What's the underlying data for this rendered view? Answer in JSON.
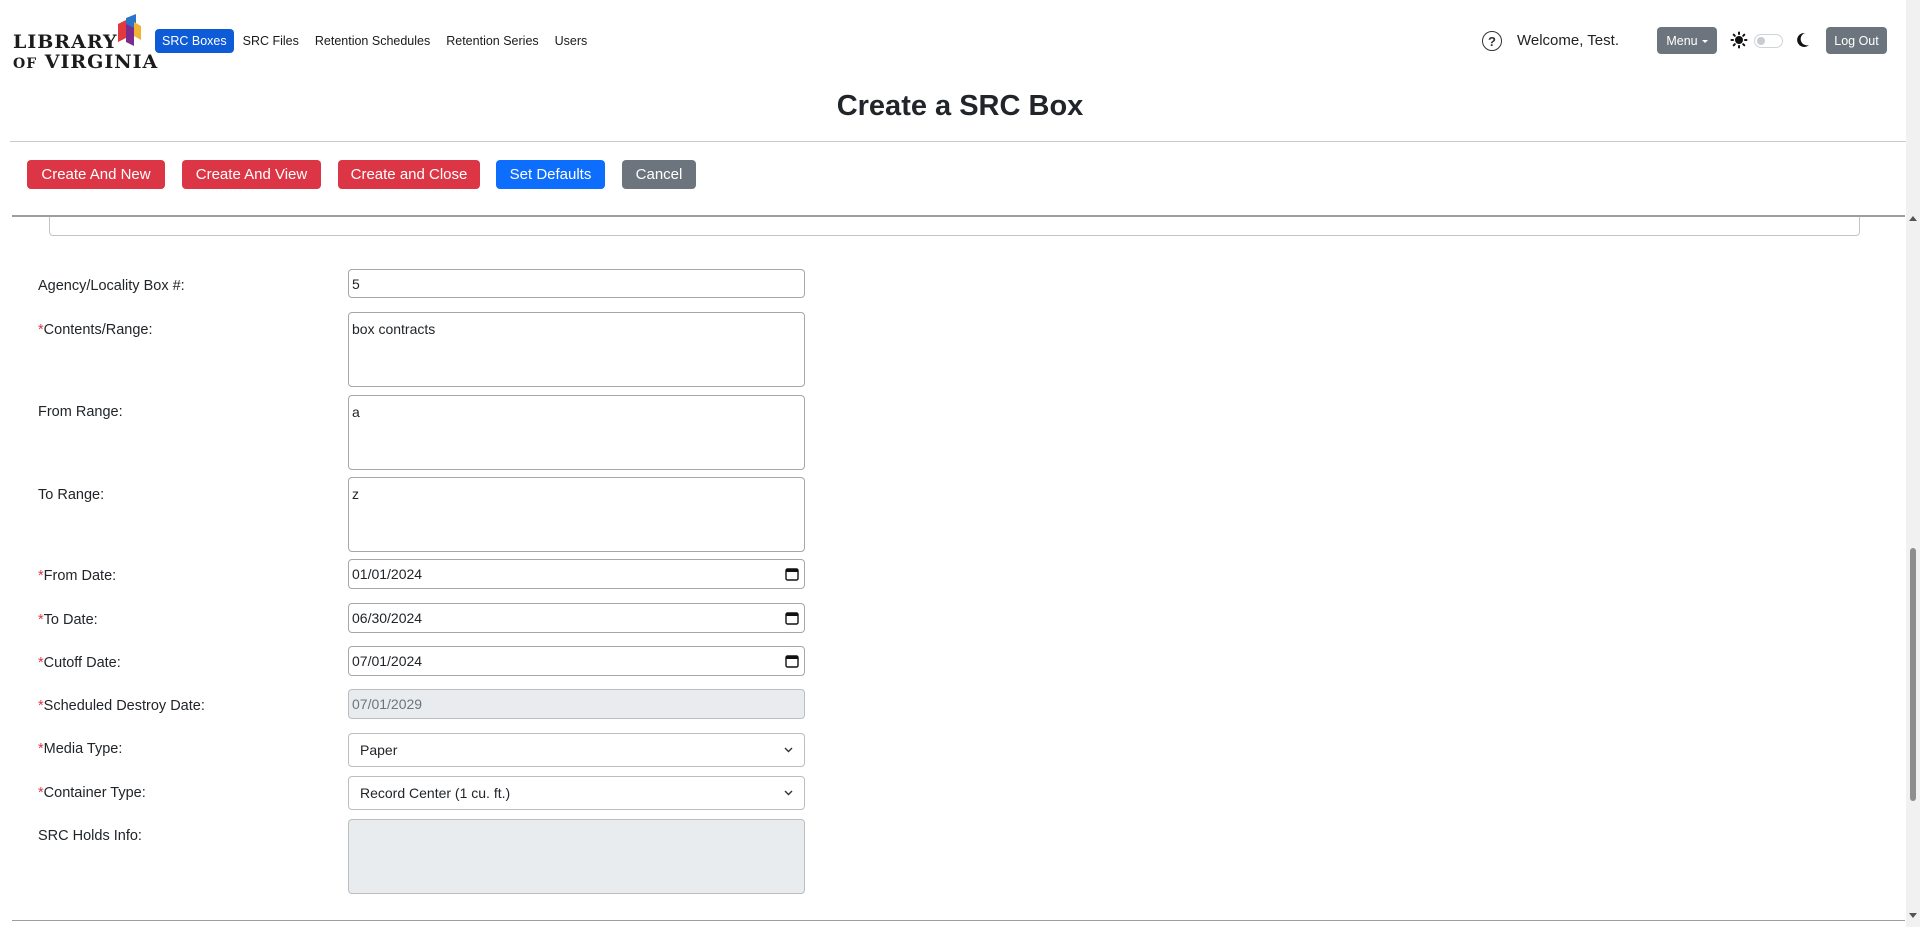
{
  "header": {
    "logo_line1": "LIBRARY",
    "logo_line2_small": "OF",
    "logo_line2": "VIRGINIA",
    "nav": [
      {
        "label": "SRC Boxes",
        "active": true
      },
      {
        "label": "SRC Files",
        "active": false
      },
      {
        "label": "Retention Schedules",
        "active": false
      },
      {
        "label": "Retention Series",
        "active": false
      },
      {
        "label": "Users",
        "active": false
      }
    ],
    "help_icon_glyph": "?",
    "welcome": "Welcome, Test.",
    "menu_label": "Menu",
    "logout_label": "Log Out",
    "icons": [
      "help-icon",
      "sun-icon",
      "theme-toggle",
      "moon-icon"
    ],
    "theme_toggle_on": false
  },
  "page_title": "Create a SRC Box",
  "toolbar": {
    "create_new": "Create And New",
    "create_view": "Create And View",
    "create_close": "Create and Close",
    "set_defaults": "Set Defaults",
    "cancel": "Cancel"
  },
  "colors": {
    "primary": "#0d6efd",
    "danger": "#dc3545",
    "secondary": "#6c757d",
    "nav_active": "#0d5bd6",
    "required": "#dc3545"
  },
  "required_marker": "*",
  "form": {
    "agency_box": {
      "label": "Agency/Locality Box #:",
      "value": "5",
      "required": false
    },
    "contents_range": {
      "label": "Contents/Range:",
      "value": "box contracts",
      "required": true
    },
    "from_range": {
      "label": "From Range:",
      "value": "a",
      "required": false
    },
    "to_range": {
      "label": "To Range:",
      "value": "z",
      "required": false
    },
    "from_date": {
      "label": "From Date:",
      "value": "01/01/2024",
      "required": true
    },
    "to_date": {
      "label": "To Date:",
      "value": "06/30/2024",
      "required": true
    },
    "cutoff_date": {
      "label": "Cutoff Date:",
      "value": "07/01/2024",
      "required": true
    },
    "destroy_date": {
      "label": "Scheduled Destroy Date:",
      "value": "07/01/2029",
      "required": true
    },
    "media_type": {
      "label": "Media Type:",
      "value": "Paper",
      "required": true
    },
    "container_type": {
      "label": "Container Type:",
      "value": "Record Center (1 cu. ft.)",
      "required": true
    },
    "holds_info": {
      "label": "SRC Holds Info:",
      "value": "",
      "required": false
    }
  }
}
